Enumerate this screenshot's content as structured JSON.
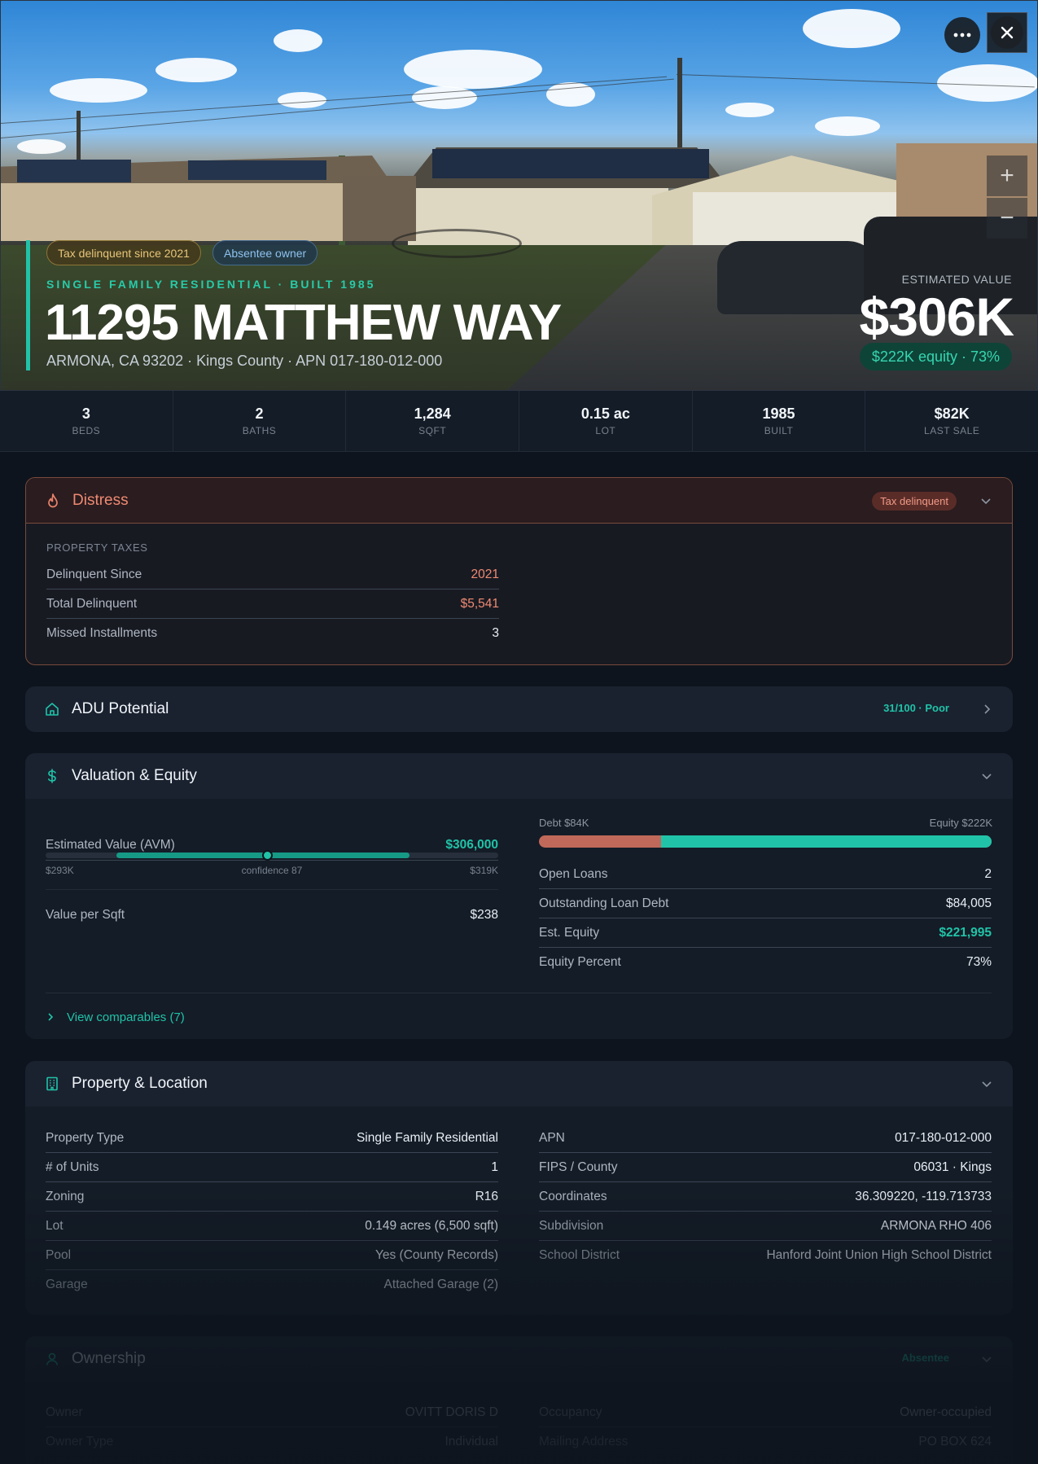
{
  "hero": {
    "tags": {
      "tax": "Tax delinquent since 2021",
      "absentee": "Absentee owner"
    },
    "subtitle": "SINGLE FAMILY RESIDENTIAL · BUILT 1985",
    "address": "11295 MATTHEW WAY",
    "location": "ARMONA, CA 93202 · Kings County · APN 017-180-012-000",
    "est_label": "ESTIMATED VALUE",
    "est_value": "$306K",
    "equity_pill": "$222K equity · 73%",
    "buttons": {
      "more": "more-icon",
      "close": "close-icon",
      "zoom_in": "+",
      "zoom_out": "−"
    }
  },
  "stats": [
    {
      "value": "3",
      "label": "BEDS"
    },
    {
      "value": "2",
      "label": "BATHS"
    },
    {
      "value": "1,284",
      "label": "SQFT"
    },
    {
      "value": "0.15 ac",
      "label": "LOT"
    },
    {
      "value": "1985",
      "label": "BUILT"
    },
    {
      "value": "$82K",
      "label": "LAST SALE"
    }
  ],
  "distress": {
    "title": "Distress",
    "badge": "Tax delinquent",
    "section": "PROPERTY TAXES",
    "rows": [
      {
        "k": "Delinquent Since",
        "v": "2021"
      },
      {
        "k": "Total Delinquent",
        "v": "$5,541"
      },
      {
        "k": "Missed Installments",
        "v": "3"
      }
    ]
  },
  "adu": {
    "title": "ADU Potential",
    "score": "31/100 · Poor"
  },
  "valuation": {
    "title": "Valuation & Equity",
    "avm_label": "Estimated Value (AVM)",
    "avm_value": "$306,000",
    "range_low": "$293K",
    "range_high": "$319K",
    "confidence": "confidence 87",
    "range_min": 281000,
    "range_max": 332000,
    "range_fill_low": 289000,
    "range_fill_high": 322000,
    "marker_value": 306000,
    "vps_label": "Value per Sqft",
    "vps_value": "$238",
    "debt_label": "Debt $84K",
    "equity_label": "Equity $222K",
    "equity_fraction": 0.73,
    "rows": [
      {
        "k": "Open Loans",
        "v": "2"
      },
      {
        "k": "Outstanding Loan Debt",
        "v": "$84,005"
      },
      {
        "k": "Est. Equity",
        "v": "$221,995"
      },
      {
        "k": "Equity Percent",
        "v": "73%"
      }
    ],
    "comparables": "View comparables (7)"
  },
  "property": {
    "title": "Property & Location",
    "left": [
      {
        "k": "Property Type",
        "v": "Single Family Residential"
      },
      {
        "k": "# of Units",
        "v": "1"
      },
      {
        "k": "Zoning",
        "v": "R16"
      },
      {
        "k": "Lot",
        "v": "0.149 acres (6,500 sqft)"
      },
      {
        "k": "Pool",
        "v": "Yes (County Records)"
      },
      {
        "k": "Garage",
        "v": "Attached Garage (2)"
      }
    ],
    "right": [
      {
        "k": "APN",
        "v": "017-180-012-000"
      },
      {
        "k": "FIPS / County",
        "v": "06031 · Kings"
      },
      {
        "k": "Coordinates",
        "v": "36.309220, -119.713733"
      },
      {
        "k": "Subdivision",
        "v": "ARMONA RHO 406"
      },
      {
        "k": "School District",
        "v": "Hanford Joint Union High School District"
      }
    ]
  },
  "ownership": {
    "title": "Ownership",
    "badge": "Absentee",
    "left": [
      {
        "k": "Owner",
        "v": "OVITT DORIS D"
      },
      {
        "k": "Owner Type",
        "v": "Individual"
      }
    ],
    "right": [
      {
        "k": "Occupancy",
        "v": "Owner-occupied"
      },
      {
        "k": "Mailing Address",
        "v": "PO BOX 624"
      }
    ]
  },
  "colors": {
    "accent": "#20c3a8",
    "distress": "#e8826a",
    "debt": "#c0695a",
    "equity": "#20c3a8"
  }
}
